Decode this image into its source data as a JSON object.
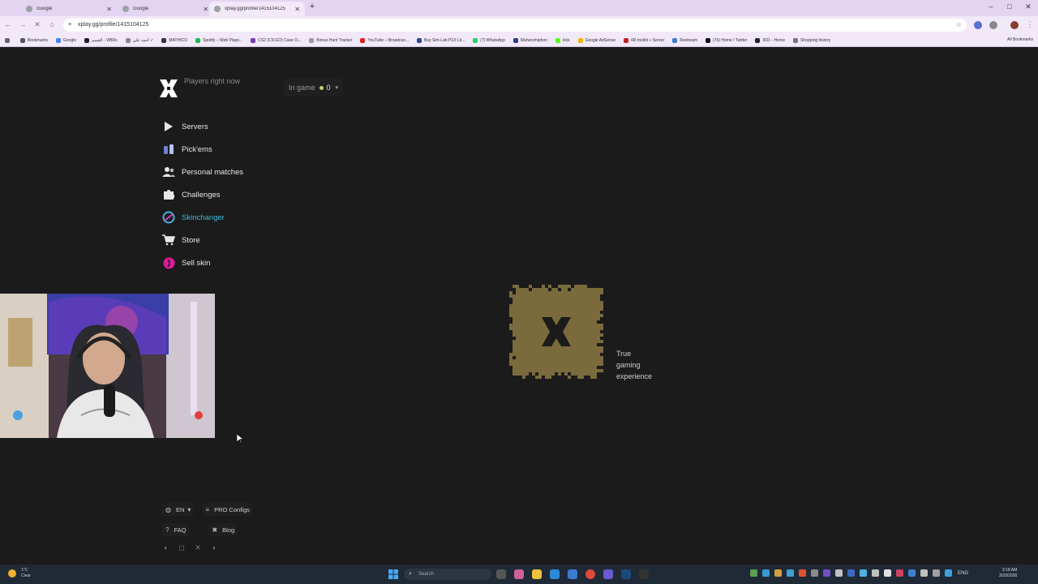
{
  "browser": {
    "tabs": [
      {
        "title": "Google",
        "active": false
      },
      {
        "title": "Google",
        "active": false
      },
      {
        "title": "xplay.gg/profile/1415104125",
        "active": true
      }
    ],
    "url": "xplay.gg/profile/1415104125",
    "bookmarks": [
      "Bookmarks",
      "Google",
      "القسم - ViBRs",
      "أحمد علي ✓",
      "MATHICO",
      "Spotify – Web Playe...",
      "CS2 (CS:GO) Case O...",
      "Bonus Hunt Tracker",
      "YouTube – Broadcas...",
      "Buy Sim-Lab P1X Lit...",
      "(7) WhatsApp",
      "Mahersmiphon",
      "kick",
      "Google AdSense",
      "IRI toolkit + Server",
      "Restream",
      "(76) Home / Twitter",
      "IDD – Home",
      "Shopping history"
    ],
    "all_bookmarks": "All Bookmarks"
  },
  "header": {
    "players_label": "Players right now",
    "ingame_label": "In game",
    "ingame_count": "0"
  },
  "nav": {
    "items": [
      {
        "label": "Servers",
        "icon": "play-icon"
      },
      {
        "label": "Pick'ems",
        "icon": "pickems-icon"
      },
      {
        "label": "Personal matches",
        "icon": "users-icon"
      },
      {
        "label": "Challenges",
        "icon": "puzzle-icon"
      },
      {
        "label": "Skinchanger",
        "icon": "skinchanger-icon",
        "accent": "#3fb8d8"
      },
      {
        "label": "Store",
        "icon": "cart-icon"
      },
      {
        "label": "Sell skin",
        "icon": "sell-skin-icon",
        "accent": "#e0189a"
      }
    ]
  },
  "main": {
    "tagline_lines": [
      "True",
      "gaming",
      "experience"
    ],
    "loader_color": "#7a6a3c"
  },
  "footer": {
    "language": "EN",
    "pro_configs": "PRO Configs",
    "faq": "FAQ",
    "blog": "Blog",
    "social": [
      "discord-icon",
      "instagram-icon",
      "x-icon",
      "steam-icon"
    ]
  },
  "taskbar": {
    "weather_temp": "1°C",
    "weather_cond": "Clear",
    "search_placeholder": "Search",
    "language": "ENG",
    "time": "3:18 AM",
    "date": "3/20/2026"
  }
}
